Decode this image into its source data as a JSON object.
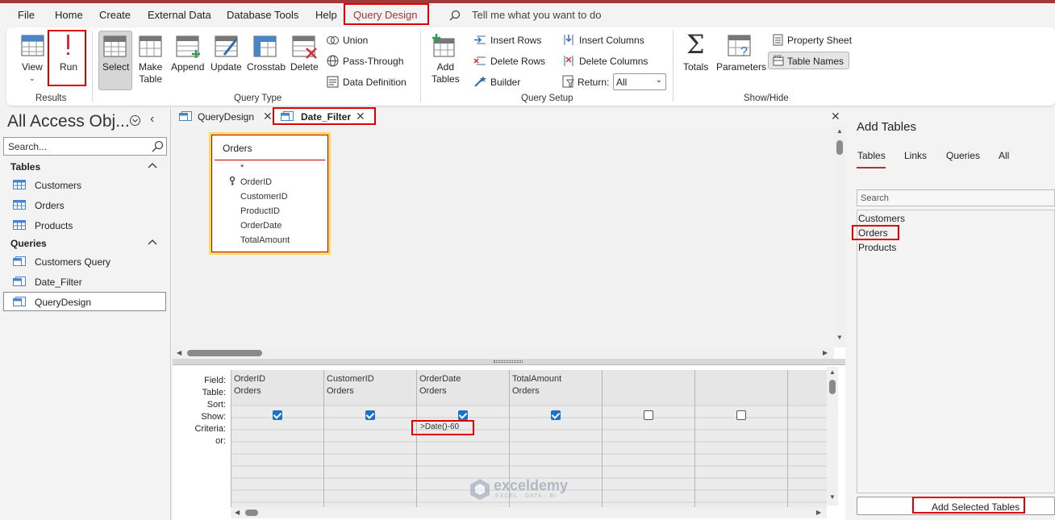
{
  "menu": {
    "file": "File",
    "home": "Home",
    "create": "Create",
    "external_data": "External Data",
    "database_tools": "Database Tools",
    "help": "Help",
    "query_design": "Query Design",
    "tell_me": "Tell me what you want to do"
  },
  "ribbon": {
    "view": "View",
    "run": "Run",
    "results_group": "Results",
    "select": "Select",
    "make_table_1": "Make",
    "make_table_2": "Table",
    "append": "Append",
    "update": "Update",
    "crosstab": "Crosstab",
    "delete": "Delete",
    "union": "Union",
    "pass_through": "Pass-Through",
    "data_definition": "Data Definition",
    "query_type_group": "Query Type",
    "add_tables_1": "Add",
    "add_tables_2": "Tables",
    "insert_rows": "Insert Rows",
    "delete_rows": "Delete Rows",
    "builder": "Builder",
    "insert_columns": "Insert Columns",
    "delete_columns": "Delete Columns",
    "return_label": "Return:",
    "return_value": "All",
    "query_setup_group": "Query Setup",
    "totals": "Totals",
    "parameters": "Parameters",
    "property_sheet": "Property Sheet",
    "table_names": "Table Names",
    "show_hide_group": "Show/Hide"
  },
  "nav": {
    "title": "All Access Obj...",
    "search_placeholder": "Search...",
    "tables_header": "Tables",
    "tables": [
      "Customers",
      "Orders",
      "Products"
    ],
    "queries_header": "Queries",
    "queries": [
      "Customers Query",
      "Date_Filter",
      "QueryDesign"
    ]
  },
  "doc_tabs": [
    "QueryDesign",
    "Date_Filter"
  ],
  "table_box": {
    "title": "Orders",
    "fields": [
      "*",
      "OrderID",
      "CustomerID",
      "ProductID",
      "OrderDate",
      "TotalAmount"
    ]
  },
  "grid": {
    "row_labels": [
      "Field:",
      "Table:",
      "Sort:",
      "Show:",
      "Criteria:",
      "or:"
    ],
    "columns": [
      {
        "field": "OrderID",
        "table": "Orders",
        "show": true,
        "criteria": ""
      },
      {
        "field": "CustomerID",
        "table": "Orders",
        "show": true,
        "criteria": ""
      },
      {
        "field": "OrderDate",
        "table": "Orders",
        "show": true,
        "criteria": ">Date()-60"
      },
      {
        "field": "TotalAmount",
        "table": "Orders",
        "show": true,
        "criteria": ""
      },
      {
        "field": "",
        "table": "",
        "show": false,
        "criteria": ""
      },
      {
        "field": "",
        "table": "",
        "show": false,
        "criteria": ""
      }
    ]
  },
  "add_tables": {
    "title": "Add Tables",
    "tabs": [
      "Tables",
      "Links",
      "Queries",
      "All"
    ],
    "search_placeholder": "Search",
    "items": [
      "Customers",
      "Orders",
      "Products"
    ],
    "button": "Add Selected Tables"
  },
  "watermark": {
    "name": "exceldemy",
    "tagline": "EXCEL · DATA · BI"
  },
  "colors": {
    "accent": "#a4373a",
    "highlight": "#e00000",
    "checkbox": "#1a73c8"
  }
}
